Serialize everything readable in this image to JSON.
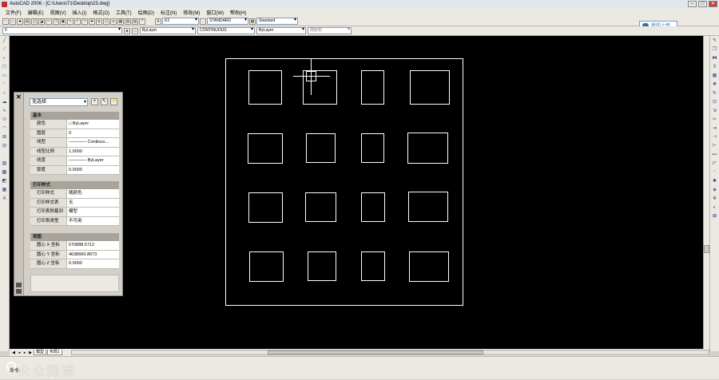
{
  "window": {
    "title": "AutoCAD 2006 - [C:\\Users\\71\\Desktop\\23.dwg]",
    "min": "–",
    "max": "□",
    "close": "✕"
  },
  "menu": [
    "文件(F)",
    "编辑(E)",
    "视图(V)",
    "插入(I)",
    "格式(O)",
    "工具(T)",
    "绘图(D)",
    "标注(N)",
    "修改(M)",
    "窗口(W)",
    "帮助(H)"
  ],
  "toolbar": {
    "textstyle": "K2",
    "dimstyle": "STANDARD",
    "tablestyle": "Standard"
  },
  "layers": {
    "current_layer": "0",
    "color": "ByLayer",
    "linetype": "CONTINUOUS",
    "lineweight": "ByLayer",
    "plotstyle": "随颜色"
  },
  "cloud_button": "我的上传",
  "properties": {
    "selection": "无选择",
    "sections": [
      {
        "title": "基本",
        "rows": [
          {
            "key": "颜色",
            "value": "□ ByLayer"
          },
          {
            "key": "图层",
            "value": "0"
          },
          {
            "key": "线型",
            "value": "———— Continuo..."
          },
          {
            "key": "线型比例",
            "value": "1.0000"
          },
          {
            "key": "线宽",
            "value": "———— ByLayer"
          },
          {
            "key": "厚度",
            "value": "0.0000"
          }
        ]
      },
      {
        "title": "打印样式",
        "rows": [
          {
            "key": "打印样式",
            "value": "随颜色"
          },
          {
            "key": "打印样式表",
            "value": "无"
          },
          {
            "key": "打印表附着到",
            "value": "模型"
          },
          {
            "key": "打印表类型",
            "value": "不可用"
          }
        ]
      },
      {
        "title": "视图",
        "rows": [
          {
            "key": "圆心 X 坐标",
            "value": "570888.5712"
          },
          {
            "key": "圆心 Y 坐标",
            "value": "4638660.8673"
          },
          {
            "key": "圆心 Z 坐标",
            "value": "0.0000"
          }
        ]
      }
    ]
  },
  "tabs": [
    "模型",
    "布局1"
  ],
  "command": "命令:",
  "watermark": "大众阅读",
  "colors": {
    "canvas": "#000000",
    "lines": "#ffffff",
    "ui": "#ece9e2"
  }
}
